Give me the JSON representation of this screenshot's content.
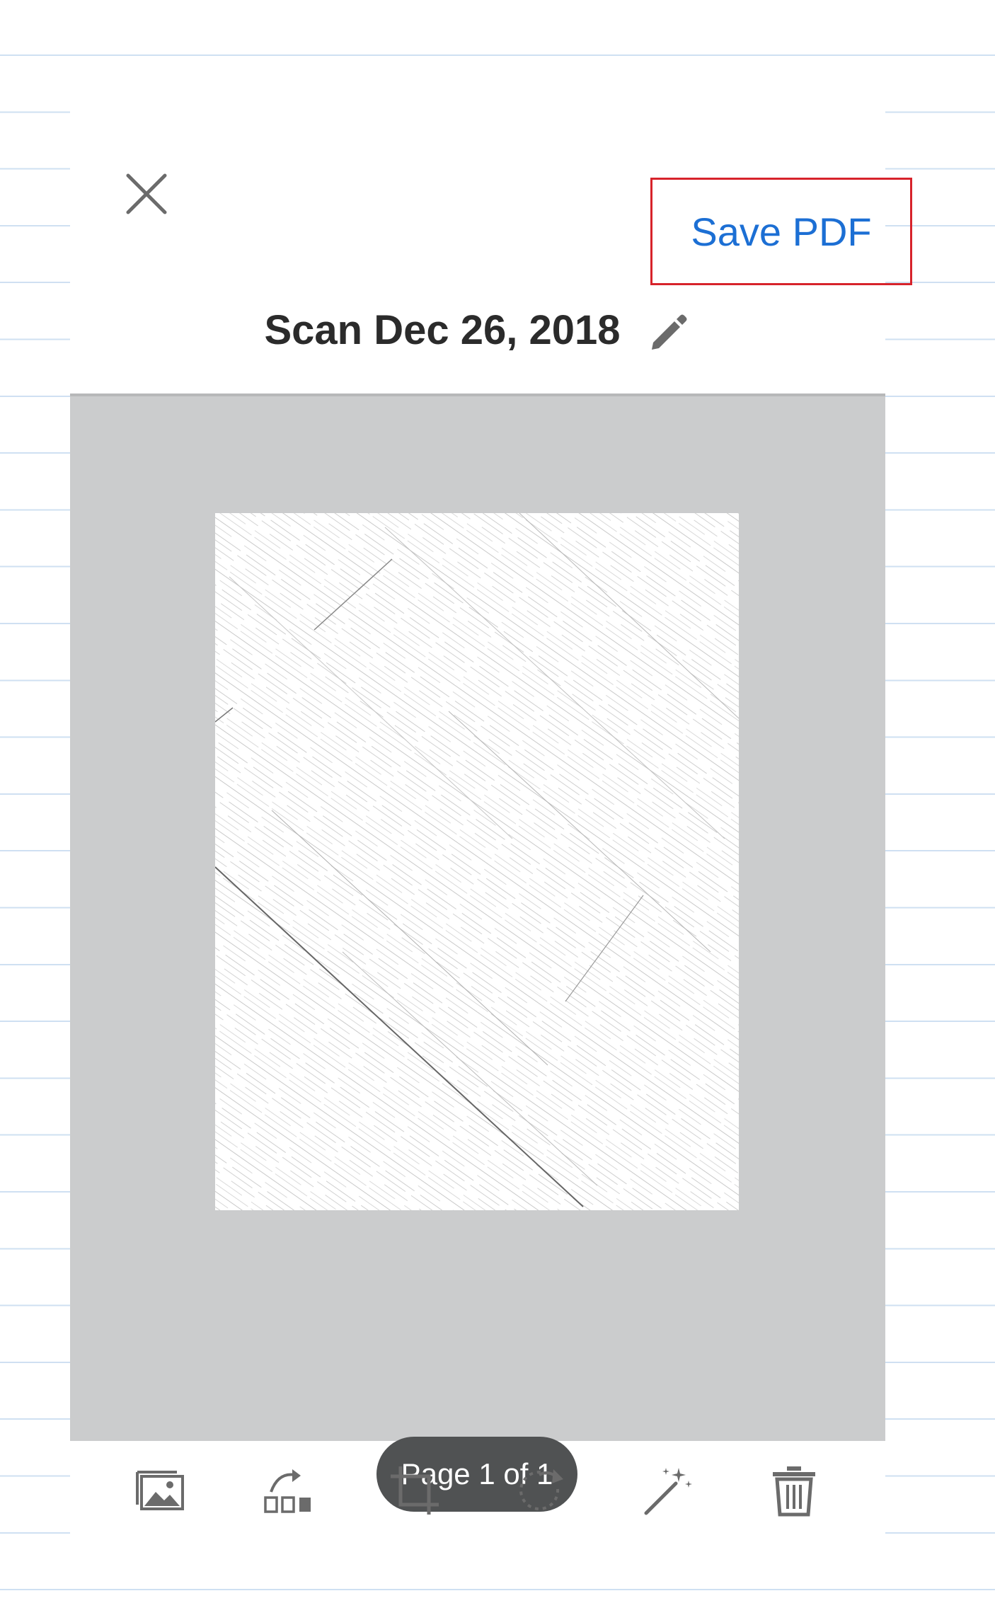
{
  "header": {
    "save_label": "Save PDF",
    "title": "Scan Dec 26, 2018"
  },
  "preview": {
    "page_indicator": "Page 1 of 1"
  },
  "toolbar": {
    "tools": [
      "add-page",
      "reorder",
      "crop",
      "rotate",
      "cleanup",
      "delete"
    ]
  },
  "colors": {
    "accent": "#1c6fd4",
    "highlight_border": "#d7232b",
    "preview_bg": "#cbcccd",
    "pill_bg": "#505253",
    "icon": "#6b6b6b"
  }
}
